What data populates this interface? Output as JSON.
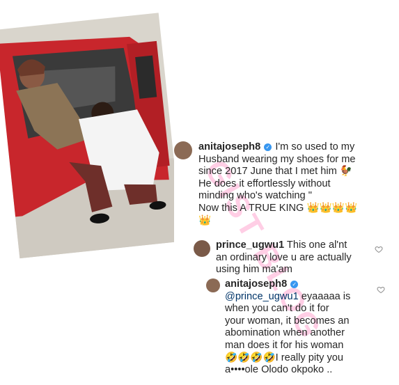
{
  "post": {
    "username": "anitajoseph8",
    "caption_lines": [
      "I'm so used to my",
      "Husband wearing my shoes for me",
      "since 2017 June that I met him 🐓",
      "He does it effortlessly without",
      "minding who's watching \"",
      "Now this A TRUE KING 👑👑👑👑",
      "👑"
    ]
  },
  "comment1": {
    "username": "prince_ugwu1",
    "lines": [
      "This one al'nt",
      "an ordinary love u are actually",
      "using him ma'am"
    ]
  },
  "reply": {
    "username": "anitajoseph8",
    "mention": "@prince_ugwu1",
    "lines": [
      "eyaaaaa is",
      "when you can't do it for",
      "your woman, it becomes an",
      "abomination when another",
      "man does it for his woman",
      "🤣🤣🤣🤣I really pity you",
      "a••••ole Olodo okpoko .."
    ]
  },
  "watermark": "GIST BLOG",
  "colors": {
    "text": "#262626",
    "verified": "#3897f0",
    "watermark": "#ff50a0"
  }
}
